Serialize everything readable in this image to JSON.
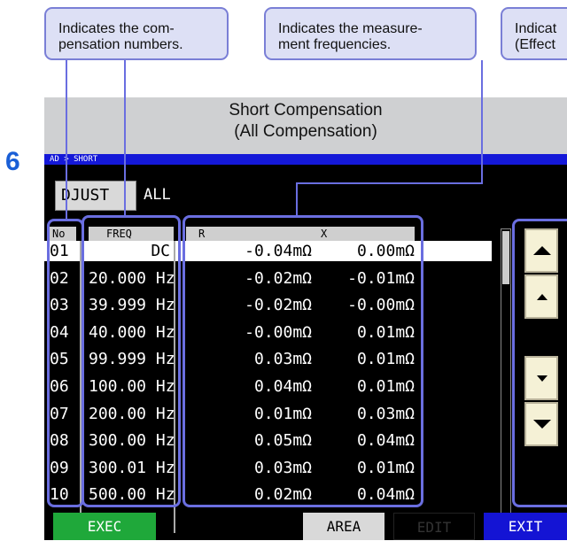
{
  "callouts": [
    {
      "text": "Indicates the com-\npensation numbers."
    },
    {
      "text": "Indicates the measure-\nment frequencies."
    },
    {
      "text": "Indicat\n(Effect"
    }
  ],
  "header": {
    "line1": "Short Compensation",
    "line2": "(All Compensation)"
  },
  "step_number": "6",
  "breadcrumb": "AD   > SHORT",
  "adjust_button": "DJUST",
  "all_label": "ALL",
  "columns": {
    "no": "No",
    "freq": "FREQ",
    "r": "R",
    "x": "X"
  },
  "rows": [
    {
      "no": "01",
      "freq": "DC",
      "r": "-0.04mΩ",
      "x": "0.00mΩ",
      "selected": true
    },
    {
      "no": "02",
      "freq": "20.000 Hz",
      "r": "-0.02mΩ",
      "x": "-0.01mΩ"
    },
    {
      "no": "03",
      "freq": "39.999 Hz",
      "r": "-0.02mΩ",
      "x": "-0.00mΩ"
    },
    {
      "no": "04",
      "freq": "40.000 Hz",
      "r": "-0.00mΩ",
      "x": "0.01mΩ"
    },
    {
      "no": "05",
      "freq": "99.999 Hz",
      "r": "0.03mΩ",
      "x": "0.01mΩ"
    },
    {
      "no": "06",
      "freq": "100.00 Hz",
      "r": "0.04mΩ",
      "x": "0.01mΩ"
    },
    {
      "no": "07",
      "freq": "200.00 Hz",
      "r": "0.01mΩ",
      "x": "0.03mΩ"
    },
    {
      "no": "08",
      "freq": "300.00 Hz",
      "r": "0.05mΩ",
      "x": "0.04mΩ"
    },
    {
      "no": "09",
      "freq": "300.01 Hz",
      "r": "0.03mΩ",
      "x": "0.01mΩ"
    },
    {
      "no": "10",
      "freq": "500.00 Hz",
      "r": "0.02mΩ",
      "x": "0.04mΩ"
    }
  ],
  "buttons": {
    "exec": "EXEC",
    "area": "AREA",
    "edit": "EDIT",
    "exit": "EXIT"
  },
  "colors": {
    "accent": "#6a6ee0",
    "exec": "#1fa83a",
    "exit": "#1414d4",
    "breadcrumb": "#1418d8"
  }
}
